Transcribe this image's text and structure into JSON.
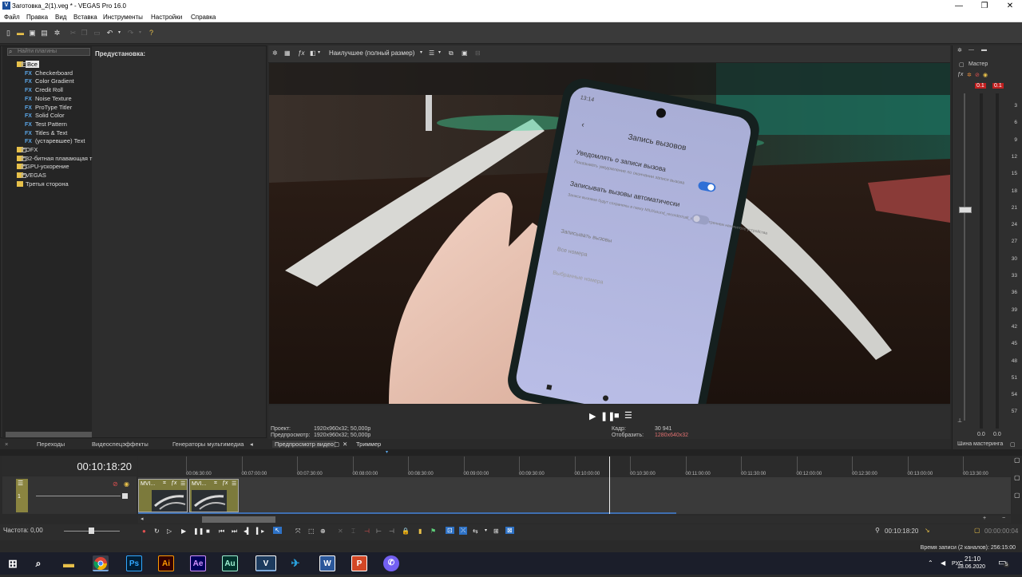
{
  "window": {
    "title": "Заготовка_2(1).veg * - VEGAS Pro 16.0",
    "app_icon_letter": "V",
    "controls": [
      "—",
      "❐",
      "✕"
    ]
  },
  "menu": [
    "Файл",
    "Правка",
    "Вид",
    "Вставка",
    "Инструменты",
    "Настройки",
    "Справка"
  ],
  "plugins": {
    "search_placeholder": "Найти плагины",
    "preset_label": "Предустановка:",
    "tree": [
      {
        "label": "Все",
        "type": "folder",
        "selected": true
      },
      {
        "label": "Checkerboard",
        "type": "fx"
      },
      {
        "label": "Color Gradient",
        "type": "fx"
      },
      {
        "label": "Credit Roll",
        "type": "fx"
      },
      {
        "label": "Noise Texture",
        "type": "fx"
      },
      {
        "label": "ProType Titler",
        "type": "fx"
      },
      {
        "label": "Solid Color",
        "type": "fx"
      },
      {
        "label": "Test Pattern",
        "type": "fx"
      },
      {
        "label": "Titles & Text",
        "type": "fx"
      },
      {
        "label": "(устаревшее) Text",
        "type": "fx"
      },
      {
        "label": "OFX",
        "type": "folder"
      },
      {
        "label": "32-битная плавающая т",
        "type": "folder"
      },
      {
        "label": "GPU-ускорение",
        "type": "folder"
      },
      {
        "label": "VEGAS",
        "type": "folder"
      },
      {
        "label": "Третья сторона",
        "type": "folder"
      }
    ],
    "fx_badge": "FX",
    "tabs": [
      "Переходы",
      "Видеоспецэффекты",
      "Генераторы мультимедиа"
    ]
  },
  "preview": {
    "quality": "Наилучшее (полный размер)",
    "project_label": "Проект:",
    "project_value": "1920x960x32; 50,000p",
    "preview_label": "Предпросмотр:",
    "preview_value": "1920x960x32; 50,000p",
    "frame_label": "Кадр:",
    "frame_value": "30 941",
    "display_label": "Отобразить:",
    "display_value": "1280x640x32",
    "tab_preview": "Предпросмотр видео",
    "tab_trimmer": "Триммер"
  },
  "phone_screen": {
    "status_time": "13:14",
    "header": "Запись вызовов",
    "item1_title": "Уведомлять о записи вызова",
    "item1_sub": "Показывать уведомление по окончании записи вызова",
    "item2_title": "Записывать вызовы автоматически",
    "item2_sub": "Записи вызовов будут сохранены в папку MIUI/sound_recorder/call_rec на внутреннем накопителе устройства",
    "section": "Записывать вызовы",
    "opt1": "Все номера",
    "opt2": "Выбранные номера"
  },
  "master": {
    "title": "Мастер",
    "peak_left": "0.1",
    "peak_right": "0.1",
    "scale": [
      "3",
      "6",
      "9",
      "12",
      "15",
      "18",
      "21",
      "24",
      "27",
      "30",
      "33",
      "36",
      "39",
      "42",
      "45",
      "48",
      "51",
      "54",
      "57"
    ],
    "bottom_left": "0.0",
    "bottom_right": "0.0",
    "tab": "Шина мастеринга"
  },
  "timeline": {
    "timecode": "00:10:18:20",
    "ruler": [
      "00:06:30:00",
      "00:07:00:00",
      "00:07:30:00",
      "00:08:00:00",
      "00:08:30:00",
      "00:09:00:00",
      "00:09:30:00",
      "00:10:00:00",
      "00:10:30:00",
      "00:11:00:00",
      "00:11:30:00",
      "00:12:00:00",
      "00:12:30:00",
      "00:13:00:00",
      "00:13:30:00"
    ],
    "playhead": 0.54,
    "clip_label": "MVI...",
    "rate_label": "Частота: 0,00",
    "cursor_time": "00:10:18:20",
    "selection_time": "00:00:00:04",
    "record_time": "Время записи (2 каналов): 256:15:00"
  },
  "taskbar": {
    "time": "21:10",
    "date": "18.06.2020",
    "lang": "РУС",
    "notif": "5",
    "apps": [
      {
        "name": "photoshop",
        "label": "Ps",
        "color": "#31a8ff",
        "bg": "#001e36"
      },
      {
        "name": "illustrator",
        "label": "Ai",
        "color": "#ff9a00",
        "bg": "#330000"
      },
      {
        "name": "after-effects",
        "label": "Ae",
        "color": "#d291ff",
        "bg": "#00005b"
      },
      {
        "name": "audition",
        "label": "Au",
        "color": "#9ff0d2",
        "bg": "#00332c"
      },
      {
        "name": "vegas",
        "label": "V",
        "color": "#ffffff",
        "bg": "#1d3b5e"
      },
      {
        "name": "word",
        "label": "W",
        "color": "#ffffff",
        "bg": "#2b579a"
      },
      {
        "name": "powerpoint",
        "label": "P",
        "color": "#ffffff",
        "bg": "#d24726"
      }
    ]
  }
}
